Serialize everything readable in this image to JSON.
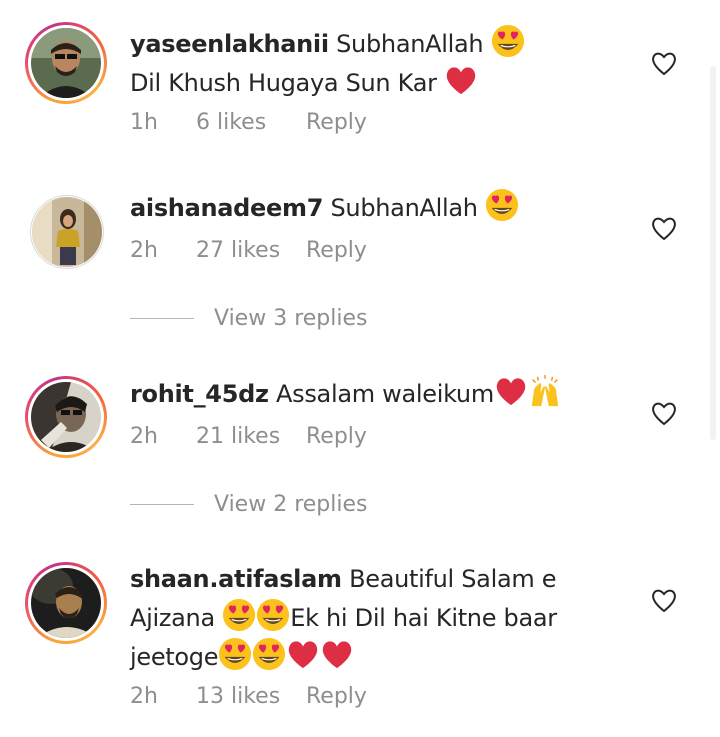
{
  "comments": [
    {
      "username": "yaseenlakhanii",
      "text1": "SubhanAllah",
      "text2": "Dil Khush Hugaya Sun Kar",
      "time": "1h",
      "likes": "6 likes",
      "reply": "Reply"
    },
    {
      "username": "aishanadeem7",
      "text1": "SubhanAllah",
      "time": "2h",
      "likes": "27 likes",
      "reply": "Reply",
      "view_replies": "View 3 replies"
    },
    {
      "username": "rohit_45dz",
      "text1": "Assalam waleikum",
      "time": "2h",
      "likes": "21 likes",
      "reply": "Reply",
      "view_replies": "View 2 replies"
    },
    {
      "username": "shaan.atifaslam",
      "text1": "Beautiful Salam e",
      "text2": "Ajizana",
      "text3": "Ek hi Dil hai Kitne baar",
      "text4": "jeetoge",
      "time": "2h",
      "likes": "13 likes",
      "reply": "Reply"
    }
  ],
  "icons": {
    "like": "heart-outline-icon",
    "heart_eyes": "heart-eyes-emoji",
    "red_heart": "red-heart-emoji",
    "raising_hands": "raising-hands-emoji"
  },
  "colors": {
    "text": "#262626",
    "meta": "#8e8e8e",
    "heart": "#e0245e",
    "emoji_face": "#fcc21b",
    "story_ring_start": "#f9a13b",
    "story_ring_end": "#c13584"
  }
}
